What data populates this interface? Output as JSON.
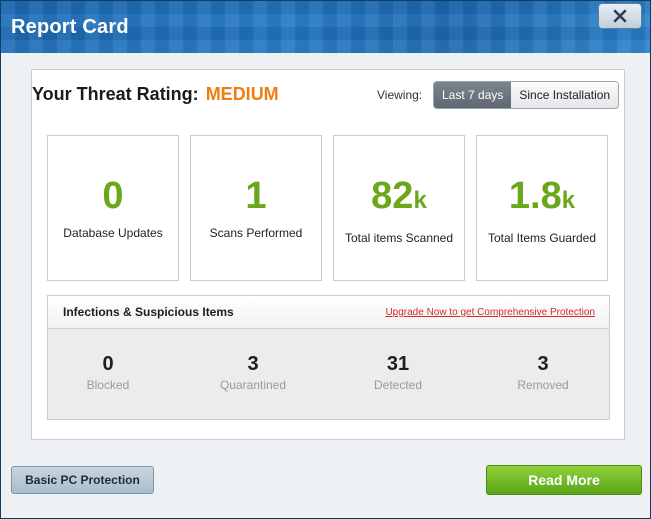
{
  "window": {
    "title": "Report Card",
    "close_icon": "close-icon"
  },
  "rating": {
    "label": "Your Threat Rating:",
    "value": "MEDIUM",
    "value_color": "#f07d10"
  },
  "viewing": {
    "label": "Viewing:",
    "options": [
      "Last 7 days",
      "Since Installation"
    ],
    "selected": "Last 7 days"
  },
  "stats": [
    {
      "value": "0",
      "unit": "",
      "label": "Database Updates"
    },
    {
      "value": "1",
      "unit": "",
      "label": "Scans Performed"
    },
    {
      "value": "82",
      "unit": "k",
      "label": "Total items Scanned"
    },
    {
      "value": "1.8",
      "unit": "k",
      "label": "Total Items Guarded"
    }
  ],
  "infections": {
    "title": "Infections & Suspicious Items",
    "link": "Upgrade Now to get Comprehensive Protection",
    "items": [
      {
        "value": "0",
        "label": "Blocked"
      },
      {
        "value": "3",
        "label": "Quarantined"
      },
      {
        "value": "31",
        "label": "Detected"
      },
      {
        "value": "3",
        "label": "Removed"
      }
    ]
  },
  "buttons": {
    "basic": "Basic PC Protection",
    "read_more": "Read More"
  },
  "colors": {
    "accent_green": "#6aa719",
    "title_blue": "#1d6cb8"
  }
}
